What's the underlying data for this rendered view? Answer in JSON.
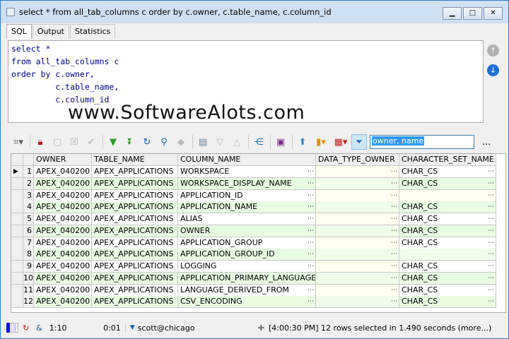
{
  "window": {
    "title": "select * from all_tab_columns c order by c.owner, c.table_name, c.column_id"
  },
  "tabs": [
    "SQL",
    "Output",
    "Statistics"
  ],
  "editor": {
    "lines": [
      "select *",
      "from all_tab_columns c",
      "order by c.owner,",
      "         c.table_name,",
      "         c.column_id"
    ]
  },
  "watermark": "www.SoftwareAlots.com",
  "toolbar": {
    "filter_value": "owner, name",
    "more": "..."
  },
  "grid": {
    "columns": [
      "OWNER",
      "TABLE_NAME",
      "COLUMN_NAME",
      "DATA_TYPE_OWNER",
      "CHARACTER_SET_NAME"
    ],
    "rows": [
      [
        "1",
        "APEX_040200",
        "APEX_APPLICATIONS",
        "WORKSPACE",
        "",
        "CHAR_CS"
      ],
      [
        "2",
        "APEX_040200",
        "APEX_APPLICATIONS",
        "WORKSPACE_DISPLAY_NAME",
        "",
        "CHAR_CS"
      ],
      [
        "3",
        "APEX_040200",
        "APEX_APPLICATIONS",
        "APPLICATION_ID",
        "",
        ""
      ],
      [
        "4",
        "APEX_040200",
        "APEX_APPLICATIONS",
        "APPLICATION_NAME",
        "",
        "CHAR_CS"
      ],
      [
        "5",
        "APEX_040200",
        "APEX_APPLICATIONS",
        "ALIAS",
        "",
        "CHAR_CS"
      ],
      [
        "6",
        "APEX_040200",
        "APEX_APPLICATIONS",
        "OWNER",
        "",
        "CHAR_CS"
      ],
      [
        "7",
        "APEX_040200",
        "APEX_APPLICATIONS",
        "APPLICATION_GROUP",
        "",
        "CHAR_CS"
      ],
      [
        "8",
        "APEX_040200",
        "APEX_APPLICATIONS",
        "APPLICATION_GROUP_ID",
        "",
        ""
      ],
      [
        "9",
        "APEX_040200",
        "APEX_APPLICATIONS",
        "LOGGING",
        "",
        "CHAR_CS"
      ],
      [
        "10",
        "APEX_040200",
        "APEX_APPLICATIONS",
        "APPLICATION_PRIMARY_LANGUAGE",
        "",
        "CHAR_CS"
      ],
      [
        "11",
        "APEX_040200",
        "APEX_APPLICATIONS",
        "LANGUAGE_DERIVED_FROM",
        "",
        "CHAR_CS"
      ],
      [
        "12",
        "APEX_040200",
        "APEX_APPLICATIONS",
        "CSV_ENCODING",
        "",
        "CHAR_CS"
      ]
    ]
  },
  "status": {
    "position": "1:10",
    "elapsed": "0:01",
    "connection": "scott@chicago",
    "message": "[4:00:30 PM]  12 rows selected in 1.490 seconds (more...)"
  }
}
